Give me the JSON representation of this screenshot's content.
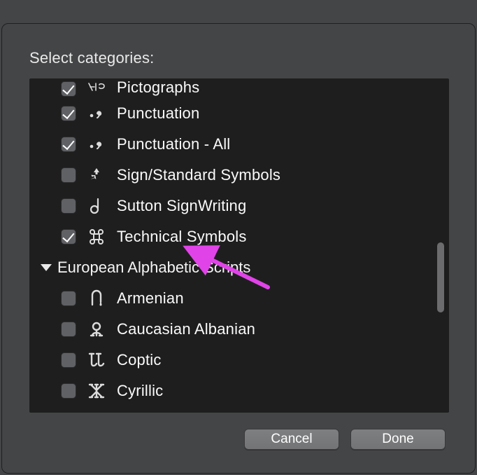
{
  "dialog": {
    "title": "Select categories:",
    "cancel_label": "Cancel",
    "done_label": "Done"
  },
  "items": [
    {
      "icon": "pictographs",
      "label": "Pictographs",
      "checked": true,
      "clipped": true
    },
    {
      "icon": "punctuation",
      "label": "Punctuation",
      "checked": true
    },
    {
      "icon": "punctuation",
      "label": "Punctuation - All",
      "checked": true
    },
    {
      "icon": "recycle",
      "label": "Sign/Standard Symbols",
      "checked": false
    },
    {
      "icon": "sutton",
      "label": "Sutton SignWriting",
      "checked": false
    },
    {
      "icon": "command",
      "label": "Technical Symbols",
      "checked": true
    }
  ],
  "group": {
    "label": "European Alphabetic Scripts",
    "expanded": true
  },
  "subitems": [
    {
      "icon": "armenian",
      "label": "Armenian",
      "checked": false
    },
    {
      "icon": "caucasian",
      "label": "Caucasian Albanian",
      "checked": false
    },
    {
      "icon": "coptic",
      "label": "Coptic",
      "checked": false
    },
    {
      "icon": "cyrillic",
      "label": "Cyrillic",
      "checked": false
    }
  ]
}
